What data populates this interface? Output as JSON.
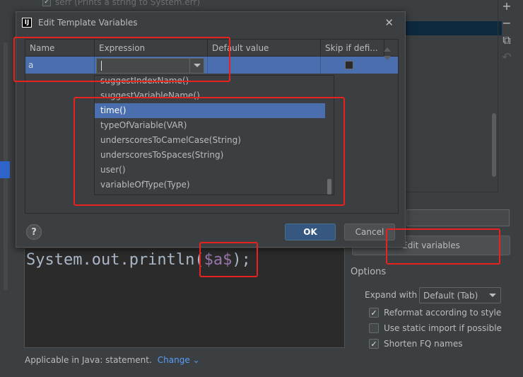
{
  "background": {
    "template_rows": [
      {
        "checked": true,
        "text": "serr (Prints a string to System.err)"
      }
    ],
    "template_text": {
      "prefix": "System.out.println(",
      "variable": "$a$",
      "suffix": ");"
    },
    "edit_variables_label": "Edit variables",
    "options": {
      "title": "Options",
      "expand_with_label": "Expand with",
      "expand_with_value": "Default (Tab)",
      "checkboxes": [
        {
          "label": "Reformat according to style",
          "checked": true
        },
        {
          "label": "Use static import if possible",
          "checked": false
        },
        {
          "label": "Shorten FQ names",
          "checked": true
        }
      ]
    },
    "footer": {
      "applicable": "Applicable in Java: statement.",
      "change_link": "Change"
    },
    "toolbar_icons": [
      "plus-icon",
      "minus-icon",
      "copy-icon",
      "undo-icon"
    ]
  },
  "dialog": {
    "title": "Edit Template Variables",
    "columns": [
      "Name",
      "Expression",
      "Default value",
      "Skip if defi..."
    ],
    "row": {
      "name": "a",
      "expression": "",
      "default_value": "",
      "skip": false
    },
    "expression_suggestions": [
      "suggestIndexName()",
      "suggestVariableName()",
      "time()",
      "typeOfVariable(VAR)",
      "underscoresToCamelCase(String)",
      "underscoresToSpaces(String)",
      "user()",
      "variableOfType(Type)"
    ],
    "selected_suggestion": "time()",
    "ok_label": "OK",
    "cancel_label": "Cancel",
    "help_label": "?"
  },
  "colors": {
    "annotation": "#e8231f",
    "selection": "#4b6eaf",
    "link": "#589df6"
  }
}
